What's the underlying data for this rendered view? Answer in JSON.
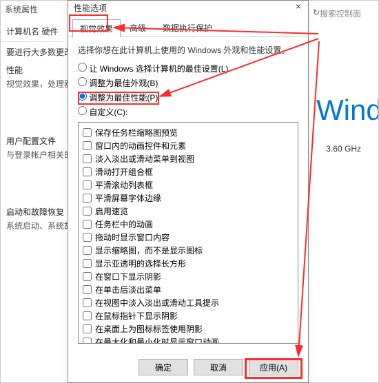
{
  "bg": {
    "breadcrumb": "系统属性",
    "tabs": "计算机名  硬件",
    "refresh": "↻",
    "search_placeholder": "搜索控制面",
    "sec1_title": "要进行大多数更改",
    "sec2_title": "性能",
    "sec2_sub": "视觉效果，处理器",
    "sec3_title": "用户配置文件",
    "sec3_sub": "与登录帐户相关的",
    "sec4_title": "启动和故障恢复",
    "sec4_sub": "系统启动、系统故",
    "wind": "Wind",
    "ghz": "3.60 GHz"
  },
  "dialog": {
    "title": "性能选项",
    "close": "×",
    "tabs": {
      "visual": "视觉效果",
      "advanced": "高级",
      "dep": "数据执行保护"
    },
    "desc": "选择你想在此计算机上使用的 Windows 外观和性能设置。",
    "radios": {
      "r1": "让 Windows 选择计算机的最佳设置(L)",
      "r2": "调整为最佳外观(B)",
      "r3": "调整为最佳性能(P)",
      "r4": "自定义(C):"
    },
    "checks": [
      "保存任务栏缩略图预览",
      "窗口内的动画控件和元素",
      "淡入淡出或滑动菜单到视图",
      "滑动打开组合框",
      "平滑滚动列表框",
      "平滑屏幕字体边缘",
      "启用速览",
      "任务栏中的动画",
      "拖动时显示窗口内容",
      "显示缩略图，而不是显示图标",
      "显示亚透明的选择长方形",
      "在窗口下显示阴影",
      "在单击后淡出菜单",
      "在视图中淡入淡出或滑动工具提示",
      "在鼠标指针下显示阴影",
      "在桌面上为图标标签使用阴影",
      "在最大化和最小化时显示窗口动画"
    ],
    "buttons": {
      "ok": "确定",
      "cancel": "取消",
      "apply": "应用(A)"
    }
  }
}
